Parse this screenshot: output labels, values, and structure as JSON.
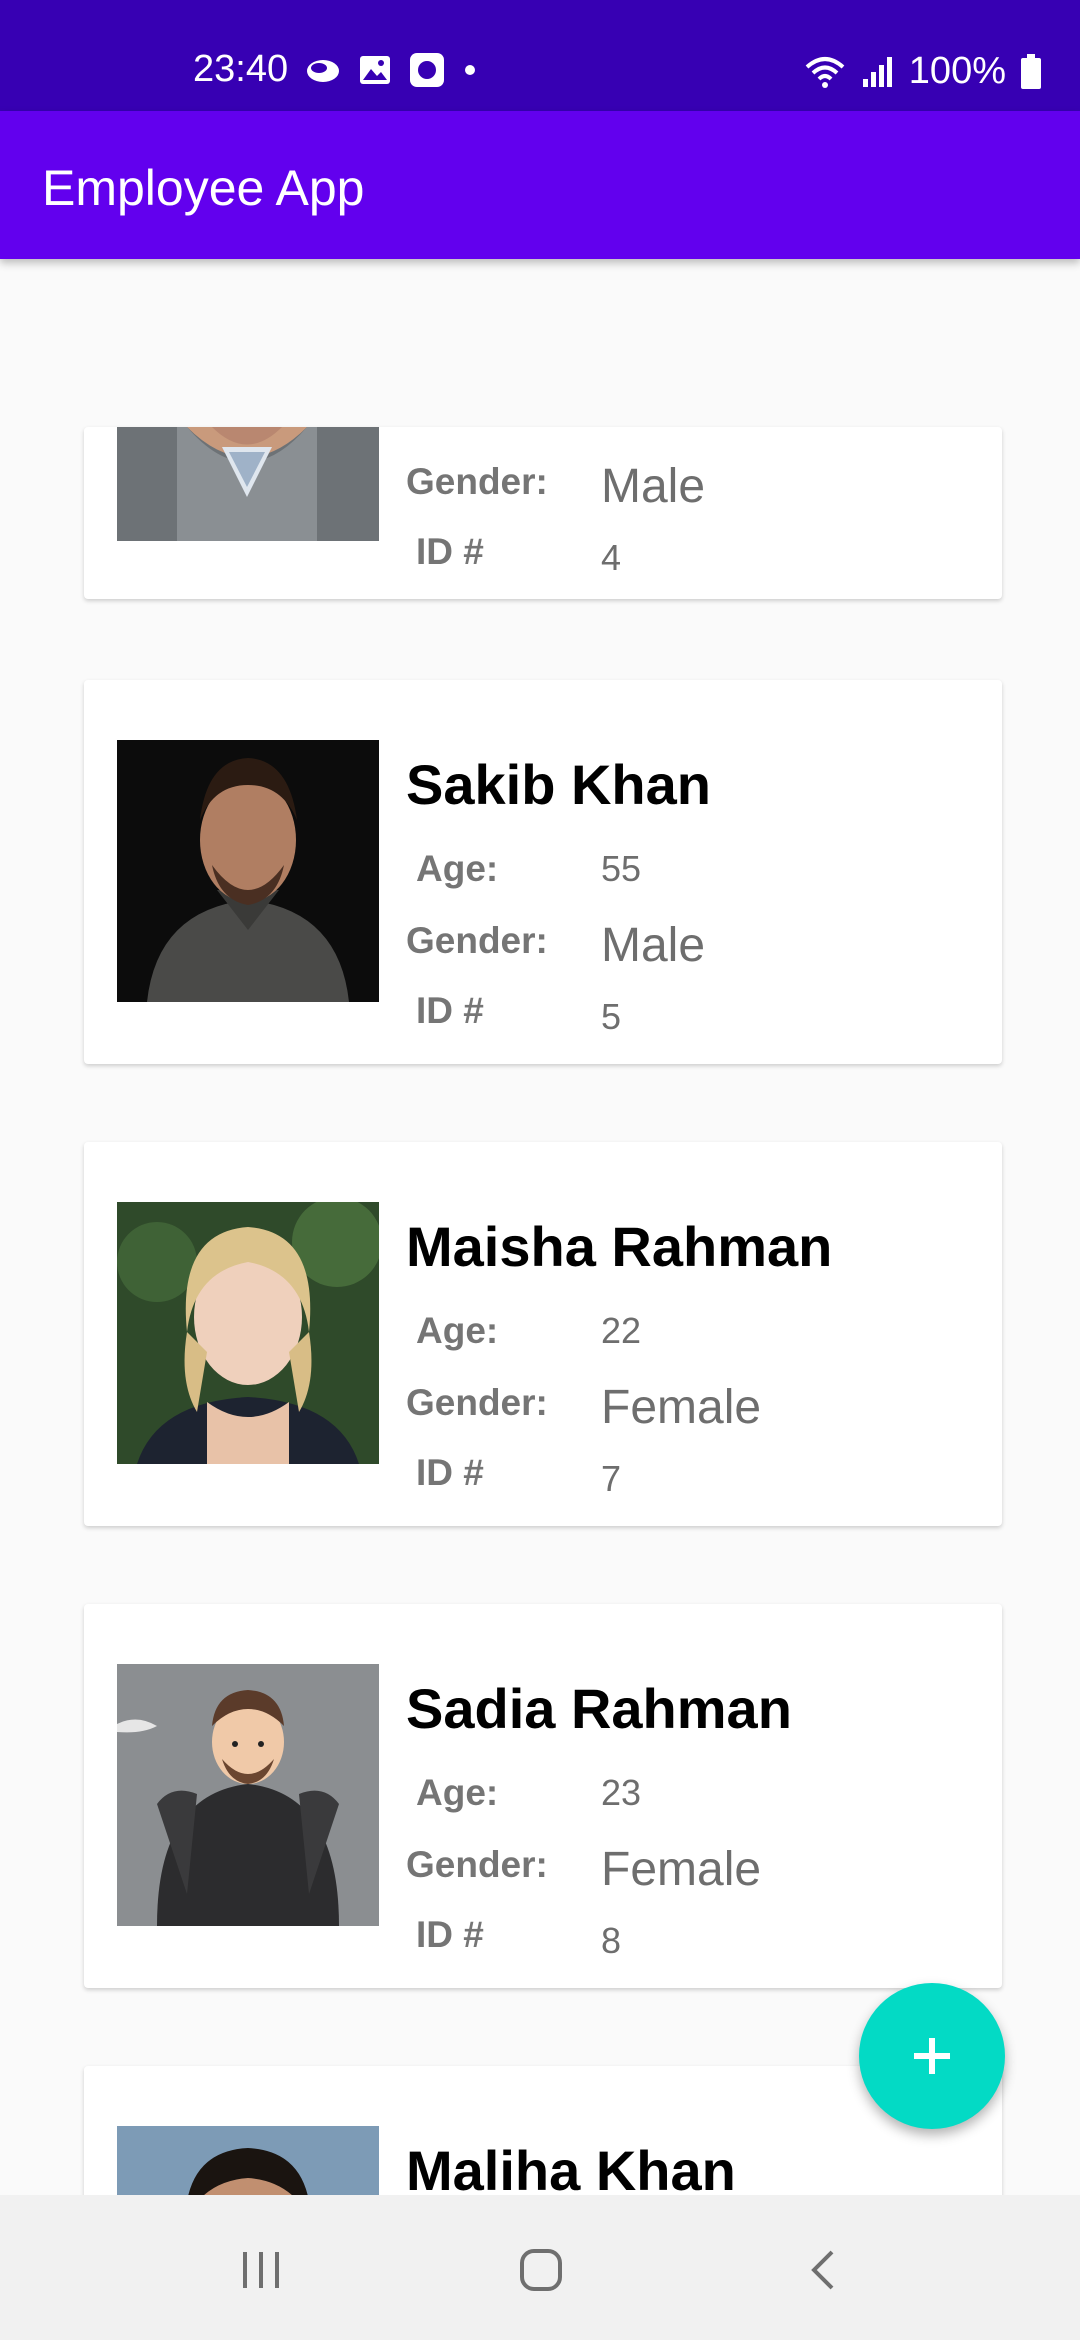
{
  "status_bar": {
    "time": "23:40",
    "battery": "100%",
    "icons_left": [
      "cloud-icon",
      "gallery-icon",
      "app-icon",
      "dot-icon"
    ],
    "icons_right": [
      "wifi-icon",
      "signal-icon",
      "battery-icon"
    ]
  },
  "app_bar": {
    "title": "Employee App"
  },
  "labels": {
    "age": "Age:",
    "gender": "Gender:",
    "id": "ID #"
  },
  "employees": [
    {
      "name": "",
      "age": "",
      "gender": "Male",
      "id": "4"
    },
    {
      "name": "Sakib Khan",
      "age": "55",
      "gender": "Male",
      "id": "5"
    },
    {
      "name": "Maisha Rahman",
      "age": "22",
      "gender": "Female",
      "id": "7"
    },
    {
      "name": "Sadia Rahman",
      "age": "23",
      "gender": "Female",
      "id": "8"
    },
    {
      "name": "Maliha Khan",
      "age": "",
      "gender": "",
      "id": ""
    }
  ],
  "fab": {
    "icon": "plus-icon"
  },
  "nav_bar": {
    "icons": [
      "recent-apps-icon",
      "home-icon",
      "back-icon"
    ]
  },
  "colors": {
    "primary": "#6200ee",
    "primary_dark": "#3700b3",
    "accent": "#03dac5"
  }
}
